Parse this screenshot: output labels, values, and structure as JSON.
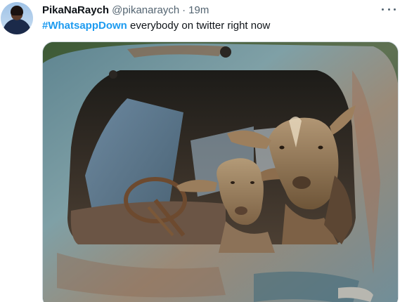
{
  "tweet": {
    "display_name": "PikaNaRaych",
    "handle": "@pikanaraych",
    "separator": "·",
    "time": "19m",
    "hashtag": "#WhatsappDown",
    "text": " everybody on twitter right now"
  },
  "icons": {
    "more": "more-dots-icon"
  },
  "colors": {
    "hashtag": "#1d9bf0",
    "secondary_text": "#536471"
  }
}
